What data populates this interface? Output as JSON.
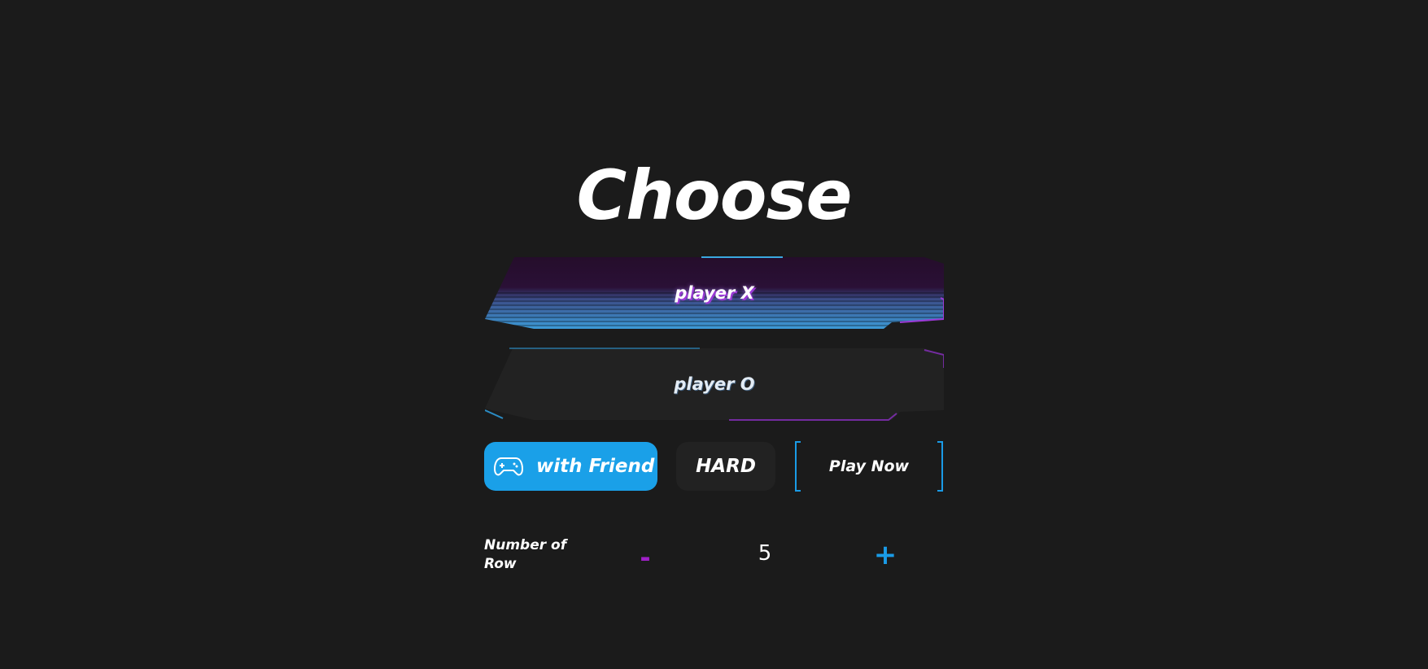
{
  "title": "Choose",
  "players": {
    "x_label": "player X",
    "o_label": "player O"
  },
  "controls": {
    "mode_label": "with Friend",
    "mode_icon": "gamepad-icon",
    "difficulty_label": "HARD",
    "play_label": "Play Now"
  },
  "rows": {
    "label": "Number of Row",
    "minus": "-",
    "value": "5",
    "plus": "+"
  },
  "colors": {
    "background": "#1b1b1b",
    "accent_blue": "#1aa0e8",
    "accent_purple": "#a020c8",
    "player_x_fill": "#250d2b"
  }
}
